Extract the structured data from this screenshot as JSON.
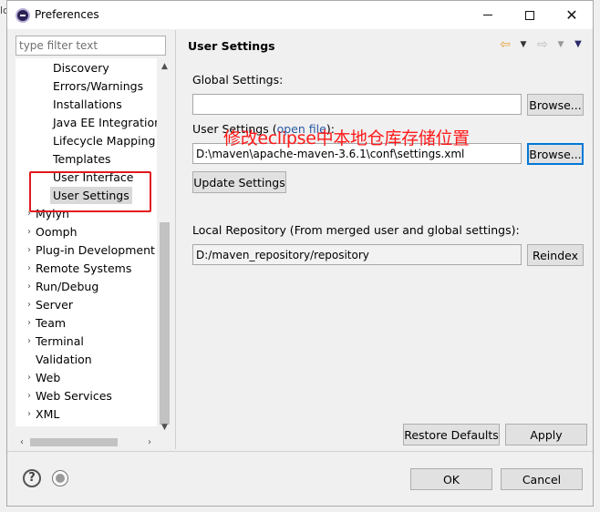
{
  "window": {
    "title": "Preferences",
    "controls": {
      "minimize": "—",
      "maximize": "☐",
      "close": "✕"
    }
  },
  "filter": {
    "placeholder": "type filter text"
  },
  "tree": {
    "child_items": [
      {
        "label": "Discovery"
      },
      {
        "label": "Errors/Warnings"
      },
      {
        "label": "Installations"
      },
      {
        "label": "Java EE Integration"
      },
      {
        "label": "Lifecycle Mapping"
      },
      {
        "label": "Templates"
      },
      {
        "label": "User Interface"
      },
      {
        "label": "User Settings",
        "selected": true
      }
    ],
    "top_items": [
      {
        "label": "Mylyn",
        "expandable": true
      },
      {
        "label": "Oomph",
        "expandable": true
      },
      {
        "label": "Plug-in Development",
        "expandable": true
      },
      {
        "label": "Remote Systems",
        "expandable": true
      },
      {
        "label": "Run/Debug",
        "expandable": true
      },
      {
        "label": "Server",
        "expandable": true
      },
      {
        "label": "Team",
        "expandable": true
      },
      {
        "label": "Terminal",
        "expandable": true
      },
      {
        "label": "Validation",
        "expandable": false
      },
      {
        "label": "Web",
        "expandable": true
      },
      {
        "label": "Web Services",
        "expandable": true
      },
      {
        "label": "XML",
        "expandable": true
      }
    ]
  },
  "page": {
    "title": "User Settings",
    "global_settings_label": "Global Settings:",
    "global_settings_value": "",
    "browse_label": "Browse...",
    "user_settings_label": "User Settings (",
    "open_file_link": "open file",
    "user_settings_label_end": "):",
    "user_settings_value": "D:\\maven\\apache-maven-3.6.1\\conf\\settings.xml",
    "annotation": "修改eclipse中本地仓库存储位置",
    "update_settings_label": "Update Settings",
    "local_repo_label": "Local Repository (From merged user and global settings):",
    "local_repo_value": "D:/maven_repository/repository",
    "reindex_label": "Reindex",
    "restore_defaults_label": "Restore Defaults",
    "apply_label": "Apply"
  },
  "footer": {
    "ok_label": "OK",
    "cancel_label": "Cancel",
    "help_icon_glyph": "?"
  },
  "colors": {
    "annotation_red": "#ff1a1a",
    "link_blue": "#2a5aa5",
    "focus_blue": "#0078d7"
  }
}
